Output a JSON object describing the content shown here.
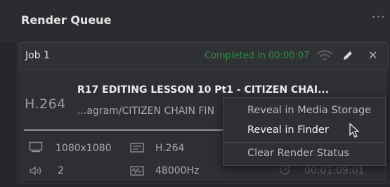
{
  "header": {
    "title": "Render Queue",
    "menu_dots": "···"
  },
  "job": {
    "name": "Job 1",
    "status": "Completed in 00:00:07",
    "status_color": "#2f8e46",
    "codec_badge": "H.264",
    "title": "R17 EDITING LESSON 10 Pt1 - CITIZEN CHAI...",
    "path": "...agram/CITIZEN CHAIN FIN",
    "resolution": "1080x1080",
    "codec": "H.264",
    "audio_channels": "2",
    "sample_rate": "48000Hz",
    "duration": "00:01:09:01",
    "icons": [
      "wifi-icon",
      "pencil-icon",
      "close-icon",
      "resolution-icon",
      "video-codec-icon",
      "audio-icon",
      "sample-rate-icon",
      "clock-icon"
    ]
  },
  "context_menu": {
    "items": [
      {
        "label": "Reveal in Media Storage"
      },
      {
        "label": "Reveal in Finder"
      },
      {
        "label": "Clear Render Status"
      }
    ]
  }
}
